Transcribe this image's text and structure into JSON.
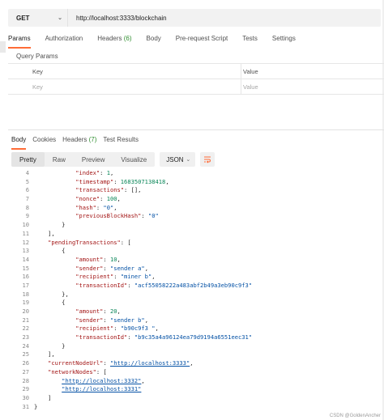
{
  "request": {
    "method": "GET",
    "url": "http://localhost:3333/blockchain"
  },
  "request_tabs": [
    {
      "label": "Params"
    },
    {
      "label": "Authorization"
    },
    {
      "label": "Headers",
      "count": "(6)"
    },
    {
      "label": "Body"
    },
    {
      "label": "Pre-request Script"
    },
    {
      "label": "Tests"
    },
    {
      "label": "Settings"
    }
  ],
  "query_params": {
    "title": "Query Params",
    "col_key": "Key",
    "col_value": "Value",
    "key_placeholder": "Key",
    "value_placeholder": "Value"
  },
  "response_tabs": [
    {
      "label": "Body"
    },
    {
      "label": "Cookies"
    },
    {
      "label": "Headers",
      "count": "(7)"
    },
    {
      "label": "Test Results"
    }
  ],
  "view_modes": [
    "Pretty",
    "Raw",
    "Preview",
    "Visualize"
  ],
  "format": "JSON",
  "code_lines": [
    {
      "n": "4",
      "indent": 12,
      "tokens": [
        [
          "k",
          "\"index\""
        ],
        [
          "p",
          ": "
        ],
        [
          "num",
          "1"
        ],
        [
          "p",
          ","
        ]
      ]
    },
    {
      "n": "5",
      "indent": 12,
      "tokens": [
        [
          "k",
          "\"timestamp\""
        ],
        [
          "p",
          ": "
        ],
        [
          "num",
          "1683507138418"
        ],
        [
          "p",
          ","
        ]
      ]
    },
    {
      "n": "6",
      "indent": 12,
      "tokens": [
        [
          "k",
          "\"transactions\""
        ],
        [
          "p",
          ": [],"
        ]
      ]
    },
    {
      "n": "7",
      "indent": 12,
      "tokens": [
        [
          "k",
          "\"nonce\""
        ],
        [
          "p",
          ": "
        ],
        [
          "num",
          "100"
        ],
        [
          "p",
          ","
        ]
      ]
    },
    {
      "n": "8",
      "indent": 12,
      "tokens": [
        [
          "k",
          "\"hash\""
        ],
        [
          "p",
          ": "
        ],
        [
          "s",
          "\"0\""
        ],
        [
          "p",
          ","
        ]
      ]
    },
    {
      "n": "9",
      "indent": 12,
      "tokens": [
        [
          "k",
          "\"previousBlockHash\""
        ],
        [
          "p",
          ": "
        ],
        [
          "s",
          "\"0\""
        ]
      ]
    },
    {
      "n": "10",
      "indent": 8,
      "tokens": [
        [
          "p",
          "}"
        ]
      ]
    },
    {
      "n": "11",
      "indent": 4,
      "tokens": [
        [
          "p",
          "],"
        ]
      ]
    },
    {
      "n": "12",
      "indent": 4,
      "tokens": [
        [
          "k",
          "\"pendingTransactions\""
        ],
        [
          "p",
          ": ["
        ]
      ]
    },
    {
      "n": "13",
      "indent": 8,
      "tokens": [
        [
          "p",
          "{"
        ]
      ]
    },
    {
      "n": "14",
      "indent": 12,
      "tokens": [
        [
          "k",
          "\"amount\""
        ],
        [
          "p",
          ": "
        ],
        [
          "num",
          "10"
        ],
        [
          "p",
          ","
        ]
      ]
    },
    {
      "n": "15",
      "indent": 12,
      "tokens": [
        [
          "k",
          "\"sender\""
        ],
        [
          "p",
          ": "
        ],
        [
          "s",
          "\"sender a\""
        ],
        [
          "p",
          ","
        ]
      ]
    },
    {
      "n": "16",
      "indent": 12,
      "tokens": [
        [
          "k",
          "\"recipient\""
        ],
        [
          "p",
          ": "
        ],
        [
          "s",
          "\"miner b\""
        ],
        [
          "p",
          ","
        ]
      ]
    },
    {
      "n": "17",
      "indent": 12,
      "tokens": [
        [
          "k",
          "\"transactionId\""
        ],
        [
          "p",
          ": "
        ],
        [
          "s",
          "\"acf55058222a483abf2b49a3eb90c9f3\""
        ]
      ]
    },
    {
      "n": "18",
      "indent": 8,
      "tokens": [
        [
          "p",
          "},"
        ]
      ]
    },
    {
      "n": "19",
      "indent": 8,
      "tokens": [
        [
          "p",
          "{"
        ]
      ]
    },
    {
      "n": "20",
      "indent": 12,
      "tokens": [
        [
          "k",
          "\"amount\""
        ],
        [
          "p",
          ": "
        ],
        [
          "num",
          "20"
        ],
        [
          "p",
          ","
        ]
      ]
    },
    {
      "n": "21",
      "indent": 12,
      "tokens": [
        [
          "k",
          "\"sender\""
        ],
        [
          "p",
          ": "
        ],
        [
          "s",
          "\"sender b\""
        ],
        [
          "p",
          ","
        ]
      ]
    },
    {
      "n": "22",
      "indent": 12,
      "tokens": [
        [
          "k",
          "\"recipient\""
        ],
        [
          "p",
          ": "
        ],
        [
          "s",
          "\"b90c9f3 \""
        ],
        [
          "p",
          ","
        ]
      ]
    },
    {
      "n": "23",
      "indent": 12,
      "tokens": [
        [
          "k",
          "\"transactionId\""
        ],
        [
          "p",
          ": "
        ],
        [
          "s",
          "\"b9c35a4a96124ea79d9194a6551eec31\""
        ]
      ]
    },
    {
      "n": "24",
      "indent": 8,
      "tokens": [
        [
          "p",
          "}"
        ]
      ]
    },
    {
      "n": "25",
      "indent": 4,
      "tokens": [
        [
          "p",
          "],"
        ]
      ]
    },
    {
      "n": "26",
      "indent": 4,
      "tokens": [
        [
          "k",
          "\"currentNodeUrl\""
        ],
        [
          "p",
          ": "
        ],
        [
          "u",
          "\"http://localhost:3333\""
        ],
        [
          "p",
          ","
        ]
      ]
    },
    {
      "n": "27",
      "indent": 4,
      "tokens": [
        [
          "k",
          "\"networkNodes\""
        ],
        [
          "p",
          ": ["
        ]
      ]
    },
    {
      "n": "28",
      "indent": 8,
      "tokens": [
        [
          "u",
          "\"http://localhost:3332\""
        ],
        [
          "p",
          ","
        ]
      ]
    },
    {
      "n": "29",
      "indent": 8,
      "tokens": [
        [
          "u",
          "\"http://localhost:3331\""
        ]
      ]
    },
    {
      "n": "30",
      "indent": 4,
      "tokens": [
        [
          "p",
          "]"
        ]
      ]
    },
    {
      "n": "31",
      "indent": 0,
      "tokens": [
        [
          "p",
          "}"
        ]
      ]
    }
  ],
  "watermark": "CSDN @GoldenAncher",
  "colors": {
    "accent": "#ff6c37",
    "json_key": "#a31515",
    "json_string": "#0451a5",
    "json_number": "#098658",
    "count_green": "#2f8f2f"
  }
}
